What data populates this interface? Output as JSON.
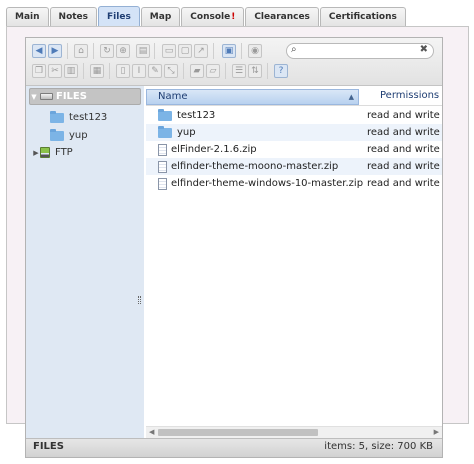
{
  "tabs": [
    {
      "label": "Main"
    },
    {
      "label": "Notes"
    },
    {
      "label": "Files"
    },
    {
      "label": "Map"
    },
    {
      "label": "Console",
      "badge": "!"
    },
    {
      "label": "Clearances"
    },
    {
      "label": "Certifications"
    }
  ],
  "toolbar": {
    "icons": [
      "back-icon",
      "forward-icon",
      "home-icon",
      "reload-icon",
      "netmount-icon",
      "upload-icon",
      "mkdir-icon",
      "mkfile-icon",
      "open-icon",
      "download-icon",
      "getfile-icon",
      "info-icon",
      "quicklook-icon",
      "copy-icon",
      "cut-icon",
      "paste-icon",
      "duplicate-icon",
      "rename-icon",
      "edit-icon",
      "resize-icon",
      "archive-icon",
      "extract-icon",
      "view-icon",
      "sort-icon",
      "help-icon"
    ],
    "search_value": "",
    "search_icon": "search-icon",
    "clear_icon": "clear-icon"
  },
  "sidebar": {
    "root": "FILES",
    "folders": [
      "test123",
      "yup"
    ],
    "ftp": "FTP"
  },
  "columns": {
    "name": "Name",
    "permissions": "Permissions"
  },
  "files": [
    {
      "name": "test123",
      "permissions": "read and write",
      "kind": "folder"
    },
    {
      "name": "yup",
      "permissions": "read and write",
      "kind": "folder"
    },
    {
      "name": "elFinder-2.1.6.zip",
      "permissions": "read and write",
      "kind": "zip"
    },
    {
      "name": "elfinder-theme-moono-master.zip",
      "permissions": "read and write",
      "kind": "zip"
    },
    {
      "name": "elfinder-theme-windows-10-master.zip",
      "permissions": "read and write",
      "kind": "zip"
    }
  ],
  "status": {
    "path": "FILES",
    "info": "items: 5, size: 700 KB"
  }
}
